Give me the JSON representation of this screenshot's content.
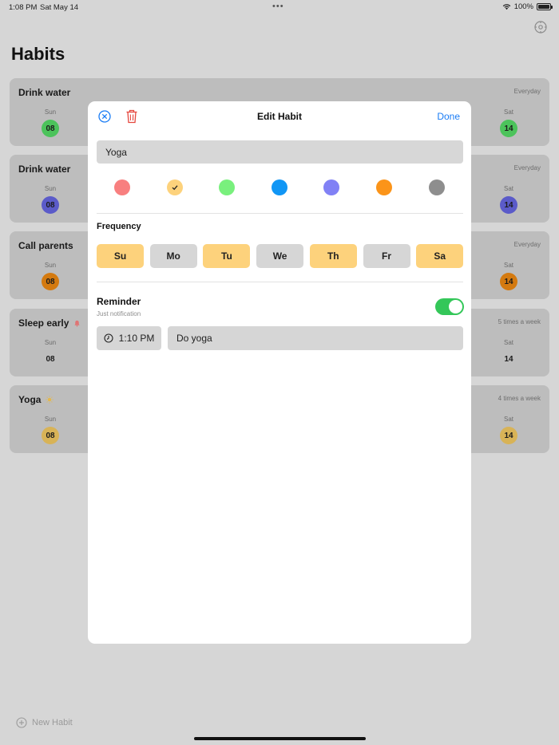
{
  "status_bar": {
    "time": "1:08 PM",
    "date": "Sat May 14",
    "dots": "•••",
    "battery": "100%"
  },
  "page_title": "Habits",
  "habits": [
    {
      "name": "Drink water",
      "frequency": "Everyday",
      "left_day": {
        "label": "Sun",
        "num": "08"
      },
      "right_day": {
        "label": "Sat",
        "num": "14"
      },
      "color": "#4cc35b",
      "icon": ""
    },
    {
      "name": "Drink water",
      "frequency": "Everyday",
      "left_day": {
        "label": "Sun",
        "num": "08"
      },
      "right_day": {
        "label": "Sat",
        "num": "14"
      },
      "color": "#5b5bc9",
      "icon": ""
    },
    {
      "name": "Call parents",
      "frequency": "Everyday",
      "left_day": {
        "label": "Sun",
        "num": "08"
      },
      "right_day": {
        "label": "Sat",
        "num": "14"
      },
      "color": "#d47a10",
      "icon": ""
    },
    {
      "name": "Sleep early",
      "frequency": "5 times a week",
      "left_day": {
        "label": "Sun",
        "num": "08"
      },
      "right_day": {
        "label": "Sat",
        "num": "14"
      },
      "color": "",
      "icon": "bell-icon"
    },
    {
      "name": "Yoga",
      "frequency": "4 times a week",
      "left_day": {
        "label": "Sun",
        "num": "08"
      },
      "right_day": {
        "label": "Sat",
        "num": "14"
      },
      "color": "#d8b357",
      "icon": "sun-icon"
    }
  ],
  "new_habit_label": "New Habit",
  "modal": {
    "title": "Edit Habit",
    "done_label": "Done",
    "name_value": "Yoga",
    "colors": [
      {
        "hex": "#f87f7f",
        "selected": false
      },
      {
        "hex": "#fdd27c",
        "selected": true
      },
      {
        "hex": "#79f07d",
        "selected": false
      },
      {
        "hex": "#1096f5",
        "selected": false
      },
      {
        "hex": "#8181f5",
        "selected": false
      },
      {
        "hex": "#fb9419",
        "selected": false
      },
      {
        "hex": "#8e8e8e",
        "selected": false
      }
    ],
    "frequency_label": "Frequency",
    "days": [
      {
        "label": "Su",
        "selected": true
      },
      {
        "label": "Mo",
        "selected": false
      },
      {
        "label": "Tu",
        "selected": true
      },
      {
        "label": "We",
        "selected": false
      },
      {
        "label": "Th",
        "selected": true
      },
      {
        "label": "Fr",
        "selected": false
      },
      {
        "label": "Sa",
        "selected": true
      }
    ],
    "reminder_label": "Reminder",
    "reminder_sub": "Just notification",
    "reminder_enabled": true,
    "time_value": "1:10 PM",
    "note_value": "Do yoga"
  }
}
